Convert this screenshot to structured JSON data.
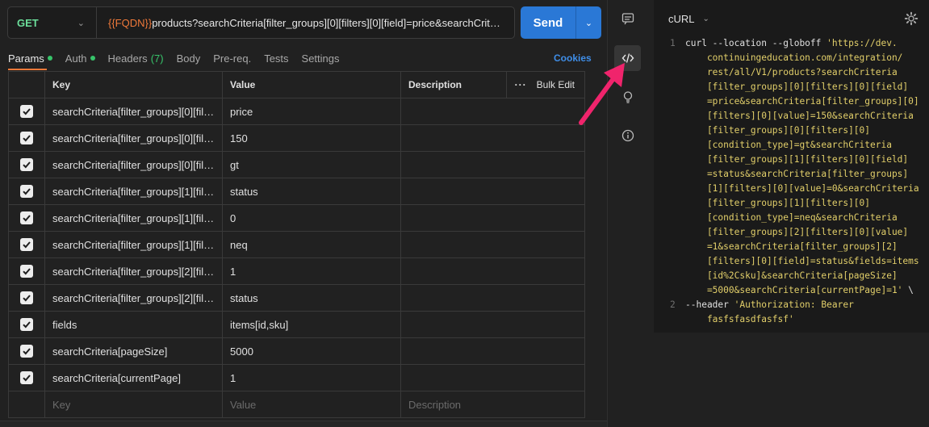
{
  "request": {
    "method": "GET",
    "url_variable": "{{FQDN}}",
    "url_rest": "products?searchCriteria[filter_groups][0][filters][0][field]=price&searchCriteria[filter_groups][0][filters][0][value]=150",
    "send_label": "Send"
  },
  "tabs": [
    {
      "label": "Params",
      "dot": true
    },
    {
      "label": "Auth",
      "dot": true
    },
    {
      "label": "Headers",
      "count": "(7)"
    },
    {
      "label": "Body"
    },
    {
      "label": "Pre-req."
    },
    {
      "label": "Tests"
    },
    {
      "label": "Settings"
    }
  ],
  "cookies_label": "Cookies",
  "table": {
    "headers": {
      "key": "Key",
      "value": "Value",
      "description": "Description",
      "bulk_edit": "Bulk Edit"
    },
    "rows": [
      {
        "key": "searchCriteria[filter_groups][0][filt...",
        "value": "price"
      },
      {
        "key": "searchCriteria[filter_groups][0][filt...",
        "value": "150"
      },
      {
        "key": "searchCriteria[filter_groups][0][filt...",
        "value": "gt"
      },
      {
        "key": "searchCriteria[filter_groups][1][filt...",
        "value": "status"
      },
      {
        "key": "searchCriteria[filter_groups][1][filt...",
        "value": "0"
      },
      {
        "key": "searchCriteria[filter_groups][1][filt...",
        "value": "neq"
      },
      {
        "key": "searchCriteria[filter_groups][2][filt...",
        "value": "1"
      },
      {
        "key": "searchCriteria[filter_groups][2][filt...",
        "value": "status"
      },
      {
        "key": "fields",
        "value": "items[id,sku]"
      },
      {
        "key": "searchCriteria[pageSize]",
        "value": "5000"
      },
      {
        "key": "searchCriteria[currentPage]",
        "value": "1"
      }
    ],
    "placeholder": {
      "key": "Key",
      "value": "Value",
      "description": "Description"
    }
  },
  "code": {
    "language_label": "cURL",
    "lines": [
      {
        "no": "1",
        "parts": [
          {
            "t": "curl --location --globoff ",
            "s": false
          },
          {
            "t": "'https://dev.",
            "s": true
          }
        ]
      },
      {
        "no": "",
        "parts": [
          {
            "t": "    continuingeducation.com/integration/",
            "s": true
          }
        ]
      },
      {
        "no": "",
        "parts": [
          {
            "t": "    rest/all/V1/products?searchCriteria",
            "s": true
          }
        ]
      },
      {
        "no": "",
        "parts": [
          {
            "t": "    [filter_groups][0][filters][0][field]",
            "s": true
          }
        ]
      },
      {
        "no": "",
        "parts": [
          {
            "t": "    =price&searchCriteria[filter_groups][0]",
            "s": true
          }
        ]
      },
      {
        "no": "",
        "parts": [
          {
            "t": "    [filters][0][value]=150&searchCriteria",
            "s": true
          }
        ]
      },
      {
        "no": "",
        "parts": [
          {
            "t": "    [filter_groups][0][filters][0]",
            "s": true
          }
        ]
      },
      {
        "no": "",
        "parts": [
          {
            "t": "    [condition_type]=gt&searchCriteria",
            "s": true
          }
        ]
      },
      {
        "no": "",
        "parts": [
          {
            "t": "    [filter_groups][1][filters][0][field]",
            "s": true
          }
        ]
      },
      {
        "no": "",
        "parts": [
          {
            "t": "    =status&searchCriteria[filter_groups]",
            "s": true
          }
        ]
      },
      {
        "no": "",
        "parts": [
          {
            "t": "    [1][filters][0][value]=0&searchCriteria",
            "s": true
          }
        ]
      },
      {
        "no": "",
        "parts": [
          {
            "t": "    [filter_groups][1][filters][0]",
            "s": true
          }
        ]
      },
      {
        "no": "",
        "parts": [
          {
            "t": "    [condition_type]=neq&searchCriteria",
            "s": true
          }
        ]
      },
      {
        "no": "",
        "parts": [
          {
            "t": "    [filter_groups][2][filters][0][value]",
            "s": true
          }
        ]
      },
      {
        "no": "",
        "parts": [
          {
            "t": "    =1&searchCriteria[filter_groups][2]",
            "s": true
          }
        ]
      },
      {
        "no": "",
        "parts": [
          {
            "t": "    [filters][0][field]=status&fields=items",
            "s": true
          }
        ]
      },
      {
        "no": "",
        "parts": [
          {
            "t": "    [id%2Csku]&searchCriteria[pageSize]",
            "s": true
          }
        ]
      },
      {
        "no": "",
        "parts": [
          {
            "t": "    =5000&searchCriteria[currentPage]=1'",
            "s": true
          },
          {
            "t": " \\",
            "s": false
          }
        ]
      },
      {
        "no": "2",
        "parts": [
          {
            "t": "--header ",
            "s": false
          },
          {
            "t": "'Authorization: Bearer",
            "s": true
          }
        ]
      },
      {
        "no": "",
        "parts": [
          {
            "t": "    fasfsfasdfasfsf'",
            "s": true
          }
        ]
      }
    ]
  },
  "colors": {
    "accent": "#2a78d6",
    "method_get": "#6bdd9a",
    "variable": "#f0793a",
    "annotation_arrow": "#f0246c"
  }
}
